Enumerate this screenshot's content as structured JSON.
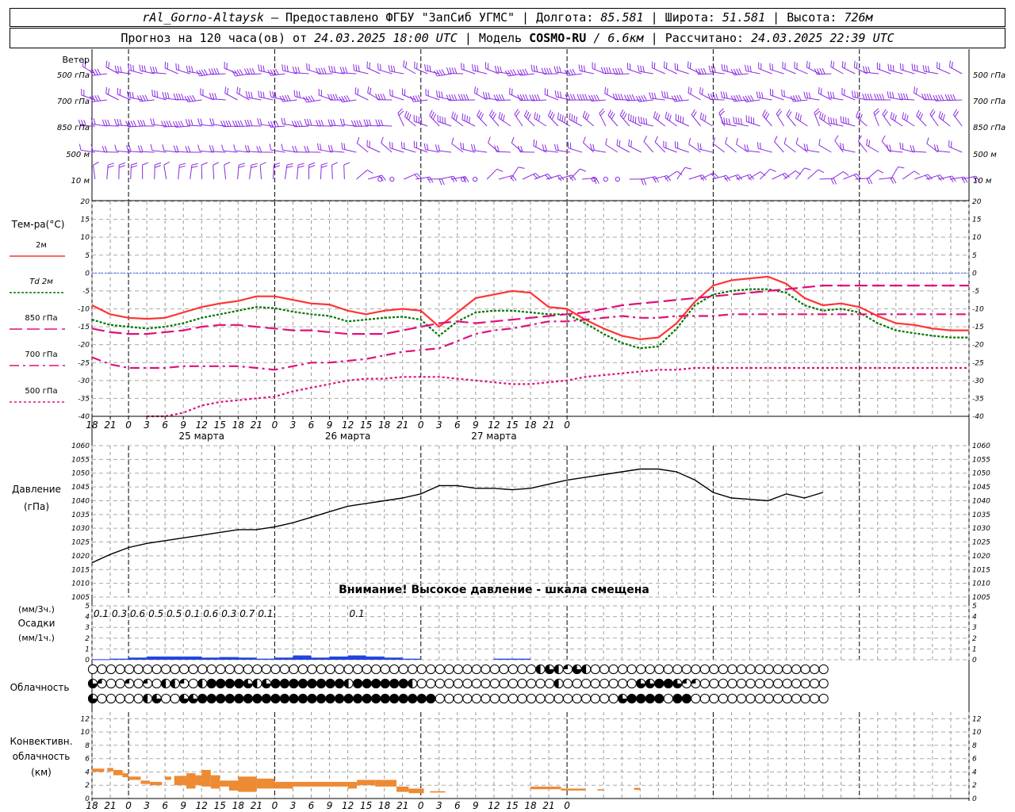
{
  "header": {
    "station": "rAl_Gorno-Altaysk",
    "provider": "Предоставлено ФГБУ \"ЗапСиб УГМС\"",
    "lon_label": "Долгота:",
    "lon_value": "85.581",
    "lat_label": "Широта:",
    "lat_value": "51.581",
    "alt_label": "Высота:",
    "alt_value": "726м",
    "forecast_label": "Прогноз на 120 часа(ов) от",
    "forecast_from": "24.03.2025 18:00 UTC",
    "model_label": "Модель",
    "model_name": "COSMO-RU",
    "model_res": "/ 6.6км",
    "computed_label": "Рассчитано:",
    "computed_at": "24.03.2025 22:39 UTC"
  },
  "wind_panel": {
    "title": "Ветер",
    "levels": [
      "500 гПа",
      "700 гПа",
      "850 гПа",
      "500 м",
      "10 м"
    ]
  },
  "temp_panel": {
    "title": "Тем-ра(°С)",
    "legend": [
      {
        "label": "2м",
        "color": "#ff3333",
        "style": "solid"
      },
      {
        "label": "Td 2м",
        "color": "#007700",
        "style": "dotted"
      },
      {
        "label": "850 гПа",
        "color": "#e0107a",
        "style": "dash"
      },
      {
        "label": "700 гПа",
        "color": "#e0107a",
        "style": "dashdot"
      },
      {
        "label": "500 гПа",
        "color": "#e0107a",
        "style": "dot"
      }
    ]
  },
  "pressure_panel": {
    "title": "Давление",
    "unit": "(гПа)",
    "warning": "Внимание! Высокое давление - шкала смещена"
  },
  "precip_panel": {
    "unit1": "(мм/3ч.)",
    "title": "Осадки",
    "unit2": "(мм/1ч.)",
    "totals": [
      "0.1",
      "0.3",
      "0.6",
      "0.5",
      "0.5",
      "0.1",
      "0.6",
      "0.3",
      "0.7",
      "0.1",
      "0.1"
    ]
  },
  "cloud_panel": {
    "title": "Облачность"
  },
  "conv_panel": {
    "title1": "Конвективн.",
    "title2": "облачность",
    "unit": "(км)"
  },
  "time_axis": {
    "hour_ticks": [
      "18",
      "21",
      "0",
      "3",
      "6",
      "9",
      "12",
      "15",
      "18",
      "21",
      "0",
      "3",
      "6",
      "9",
      "12",
      "15",
      "18",
      "21",
      "0",
      "3",
      "6",
      "9",
      "12",
      "15",
      "18",
      "21",
      "0"
    ],
    "day_labels": [
      "25 марта",
      "26 марта",
      "27 марта"
    ]
  },
  "colors": {
    "wind": "#8a2be2",
    "temp2m": "#ff3333",
    "dew": "#007700",
    "upper": "#e0107a",
    "pressure": "#000000",
    "precip": "#2244dd",
    "conv": "#ee8a33",
    "zero_line": "#3355ff"
  },
  "chart_data": [
    {
      "type": "line",
      "title": "Тем-ра(°С)",
      "x_unit": "hours since 24.03.2025 18:00 UTC",
      "ylim": [
        -40,
        20
      ],
      "yticks": [
        -40,
        -35,
        -30,
        -25,
        -20,
        -15,
        -10,
        -5,
        0,
        5,
        10,
        15,
        20
      ],
      "x": [
        0,
        3,
        6,
        9,
        12,
        15,
        18,
        21,
        24,
        27,
        30,
        33,
        36,
        39,
        42,
        45,
        48,
        51,
        54,
        57,
        60,
        63,
        66,
        69,
        72,
        75,
        78,
        81,
        84,
        87,
        90,
        93,
        96,
        99,
        102,
        105,
        108,
        111,
        114,
        117,
        120,
        123,
        126,
        129,
        132,
        135,
        138,
        141,
        144
      ],
      "series": [
        {
          "name": "2м",
          "values": [
            -9,
            -11.5,
            -12.5,
            -12.8,
            -12.5,
            -11,
            -9.5,
            -8.5,
            -7.8,
            -6.5,
            -6.5,
            -7.5,
            -8.5,
            -8.8,
            -10.5,
            -11.5,
            -10.5,
            -10,
            -10.5,
            -15,
            -11,
            -7,
            -6,
            -5,
            -5.5,
            -9.5,
            -10,
            -13,
            -15.5,
            -17.5,
            -18.5,
            -18,
            -14,
            -8,
            -3.5,
            -2,
            -1.5,
            -1,
            -3,
            -7,
            -9,
            -8.5,
            -9.5,
            -12,
            -14,
            -14.5,
            -15.5,
            -16,
            -16
          ]
        },
        {
          "name": "Td 2м",
          "values": [
            -13,
            -14.5,
            -15,
            -15.5,
            -15,
            -14,
            -12.5,
            -11.5,
            -10.5,
            -9.5,
            -9.8,
            -10.8,
            -11.5,
            -12,
            -13.5,
            -13,
            -12.5,
            -12.2,
            -13,
            -17.5,
            -13.5,
            -11,
            -10.5,
            -10.5,
            -11,
            -11.5,
            -11.5,
            -14,
            -17,
            -19.5,
            -21,
            -20.5,
            -15.5,
            -9,
            -6,
            -5,
            -4.5,
            -4.5,
            -5.5,
            -9,
            -10.5,
            -10,
            -11,
            -14,
            -16,
            -16.8,
            -17.5,
            -18,
            -18
          ]
        },
        {
          "name": "850 гПа",
          "values": [
            -15.5,
            -16.5,
            -17,
            -17,
            -16.5,
            -16,
            -15,
            -14.5,
            -14.5,
            -15,
            -15.5,
            -16,
            -16,
            -16.5,
            -17,
            -17,
            -17,
            -16,
            -15,
            -14,
            -13.5,
            -14,
            -13.5,
            -13,
            -12.5,
            -12,
            -11.5,
            -11,
            -10,
            -9,
            -8.5,
            -8,
            -7.5,
            -7,
            -6.5,
            -6,
            -5.5,
            -5,
            -4.5,
            -4,
            -3.5,
            -3.5,
            -3.5,
            -3.5,
            -3.5,
            -3.5,
            -3.5,
            -3.5,
            -3.5
          ]
        },
        {
          "name": "700 гПа",
          "values": [
            -23.5,
            -25.5,
            -26.5,
            -26.5,
            -26.5,
            -26,
            -26,
            -26,
            -26,
            -26.5,
            -27,
            -26,
            -25,
            -25,
            -24.5,
            -24,
            -23,
            -22,
            -21.5,
            -21,
            -19,
            -17,
            -16,
            -15.5,
            -14.5,
            -13.5,
            -13.5,
            -13,
            -12.5,
            -12,
            -12.5,
            -12.5,
            -12,
            -12,
            -12,
            -11.5,
            -11.5,
            -11.5,
            -11.5,
            -11.5,
            -11.5,
            -11.5,
            -11.5,
            -11.5,
            -11.5,
            -11.5,
            -11.5,
            -11.5,
            -11.5
          ]
        },
        {
          "name": "500 гПа",
          "values": [
            -45,
            -43,
            -42,
            -41,
            -40,
            -39,
            -37,
            -36,
            -35.5,
            -35,
            -34.5,
            -33,
            -32,
            -31,
            -30,
            -29.5,
            -29.5,
            -29,
            -29,
            -29,
            -29.5,
            -30,
            -30.5,
            -31,
            -31,
            -30.5,
            -30,
            -29,
            -28.5,
            -28,
            -27.5,
            -27,
            -27,
            -26.5,
            -26.5,
            -26.5,
            -26.5,
            -26.5,
            -26.5,
            -26.5,
            -26.5,
            -26.5,
            -26.5,
            -26.5,
            -26.5,
            -26.5,
            -26.5,
            -26.5,
            -26.5
          ]
        }
      ]
    },
    {
      "type": "line",
      "title": "Давление",
      "ylabel": "(гПа)",
      "x_unit": "hours since 24.03.2025 18:00 UTC",
      "ylim": [
        1005,
        1060
      ],
      "yticks": [
        1005,
        1010,
        1015,
        1020,
        1025,
        1030,
        1035,
        1040,
        1045,
        1050,
        1055,
        1060
      ],
      "x": [
        0,
        3,
        6,
        9,
        12,
        15,
        18,
        21,
        24,
        27,
        30,
        33,
        36,
        39,
        42,
        45,
        48,
        51,
        54,
        57,
        60,
        63,
        66,
        69,
        72,
        75,
        78,
        81,
        84,
        87,
        90,
        93,
        96,
        99,
        102,
        105,
        108,
        111,
        114,
        117,
        120
      ],
      "series": [
        {
          "name": "",
          "values": [
            1017.5,
            1020.5,
            1023,
            1024.5,
            1025.5,
            1026.5,
            1027.5,
            1028.5,
            1029.5,
            1029.5,
            1030.5,
            1032,
            1034,
            1036,
            1038,
            1039,
            1040,
            1041,
            1042.5,
            1045.5,
            1045.5,
            1044.5,
            1044.5,
            1044,
            1044.5,
            1046,
            1047.5,
            1048.5,
            1049.5,
            1050.5,
            1051.5,
            1051.5,
            1050.5,
            1047.5,
            1043,
            1041,
            1040.5,
            1040,
            1042.5,
            1041,
            1043
          ]
        }
      ]
    },
    {
      "type": "bar",
      "title": "Осадки",
      "ylabel": "(мм/3ч.) (мм/1ч.)",
      "x_unit": "hours since 24.03.2025 18:00 UTC",
      "ylim": [
        0,
        5
      ],
      "yticks": [
        0,
        1,
        2,
        3,
        4,
        5
      ],
      "x": [
        3,
        6,
        9,
        12,
        15,
        18,
        21,
        24,
        27,
        30,
        33,
        36,
        39,
        42,
        45,
        48,
        51,
        54,
        69,
        72
      ],
      "values": [
        0.05,
        0.1,
        0.2,
        0.3,
        0.3,
        0.3,
        0.2,
        0.25,
        0.2,
        0.1,
        0.2,
        0.4,
        0.2,
        0.3,
        0.4,
        0.3,
        0.2,
        0.1,
        0.1,
        0.1
      ],
      "labels_3h": [
        {
          "x": 1.5,
          "text": "0.1"
        },
        {
          "x": 4.5,
          "text": "0.3"
        },
        {
          "x": 7.5,
          "text": "0.6"
        },
        {
          "x": 10.5,
          "text": "0.5"
        },
        {
          "x": 13.5,
          "text": "0.5"
        },
        {
          "x": 16.5,
          "text": "0.1"
        },
        {
          "x": 19.5,
          "text": "0.6"
        },
        {
          "x": 22.5,
          "text": "0.3"
        },
        {
          "x": 25.5,
          "text": "0.7"
        },
        {
          "x": 28.5,
          "text": "0.1"
        },
        {
          "x": 43.5,
          "text": "0.1"
        }
      ]
    },
    {
      "type": "heatmap",
      "title": "Облачность",
      "rows": [
        "upper",
        "middle",
        "lower"
      ],
      "x_unit": "hours since 24.03.2025 18:00 UTC",
      "x_step_hours": 1.5,
      "cover_scale": "0=clear, 1=quarter, 2=half, 3=three-quarters, 4=overcast",
      "values": [
        [
          0,
          0,
          0,
          0,
          0,
          0,
          0,
          0,
          0,
          0,
          0,
          0,
          0,
          0,
          0,
          0,
          0,
          0,
          0,
          0,
          0,
          0,
          0,
          0,
          0,
          0,
          0,
          0,
          0,
          0,
          0,
          0,
          0,
          0,
          0,
          0,
          0,
          0,
          0,
          0,
          0,
          0,
          0,
          0,
          0,
          0,
          0,
          0,
          0,
          2,
          3,
          2,
          1,
          3,
          2,
          0,
          0,
          0,
          0,
          0,
          0,
          0,
          0,
          0,
          0,
          0,
          0,
          0,
          0,
          0,
          0,
          0,
          0,
          0,
          0,
          0,
          0,
          0,
          0,
          0,
          0
        ],
        [
          3,
          1,
          0,
          0,
          1,
          0,
          1,
          0,
          2,
          2,
          1,
          0,
          2,
          4,
          4,
          4,
          4,
          3,
          2,
          3,
          4,
          4,
          4,
          4,
          4,
          4,
          4,
          4,
          2,
          4,
          4,
          4,
          4,
          4,
          4,
          2,
          0,
          0,
          0,
          0,
          0,
          0,
          0,
          0,
          0,
          0,
          0,
          0,
          0,
          0,
          0,
          2,
          0,
          0,
          0,
          0,
          0,
          0,
          0,
          0,
          3,
          3,
          4,
          4,
          3,
          1,
          1,
          0,
          0,
          0,
          0,
          0,
          0,
          0,
          0,
          0,
          0,
          0,
          0,
          0,
          0
        ],
        [
          3,
          0,
          0,
          0,
          0,
          0,
          2,
          3,
          0,
          0,
          3,
          3,
          4,
          4,
          4,
          4,
          4,
          4,
          4,
          4,
          4,
          4,
          4,
          4,
          4,
          4,
          4,
          4,
          4,
          4,
          4,
          4,
          4,
          4,
          4,
          4,
          4,
          4,
          0,
          0,
          0,
          0,
          0,
          0,
          0,
          0,
          0,
          0,
          0,
          0,
          0,
          0,
          0,
          0,
          0,
          0,
          0,
          0,
          3,
          4,
          4,
          4,
          4,
          0,
          4,
          4,
          0,
          0,
          0,
          0,
          0,
          0,
          0,
          0,
          0,
          0,
          0,
          0,
          0,
          0,
          0
        ]
      ]
    },
    {
      "type": "bar",
      "title": "Конвективн. облачность",
      "ylabel": "(км)",
      "x_unit": "hours since 24.03.2025 18:00 UTC",
      "ylim": [
        0,
        13
      ],
      "yticks": [
        0,
        2,
        4,
        6,
        8,
        10,
        12
      ],
      "segments": [
        {
          "x0": 0,
          "x1": 2,
          "bottom": 4.0,
          "top": 4.5
        },
        {
          "x0": 2.5,
          "x1": 3.5,
          "bottom": 4.1,
          "top": 4.6
        },
        {
          "x0": 3.5,
          "x1": 5,
          "bottom": 3.5,
          "top": 4.3
        },
        {
          "x0": 5,
          "x1": 6,
          "bottom": 3.2,
          "top": 3.8
        },
        {
          "x0": 6,
          "x1": 8,
          "bottom": 2.8,
          "top": 3.3
        },
        {
          "x0": 8,
          "x1": 9.5,
          "bottom": 2.2,
          "top": 2.7
        },
        {
          "x0": 9.5,
          "x1": 11.5,
          "bottom": 2.0,
          "top": 2.5
        },
        {
          "x0": 12,
          "x1": 13,
          "bottom": 2.8,
          "top": 3.3
        },
        {
          "x0": 13.5,
          "x1": 15.5,
          "bottom": 2.0,
          "top": 3.4
        },
        {
          "x0": 15.5,
          "x1": 17,
          "bottom": 1.5,
          "top": 3.8
        },
        {
          "x0": 17,
          "x1": 18,
          "bottom": 2.0,
          "top": 3.5
        },
        {
          "x0": 18,
          "x1": 19.5,
          "bottom": 1.8,
          "top": 4.3
        },
        {
          "x0": 19.5,
          "x1": 21,
          "bottom": 1.5,
          "top": 3.5
        },
        {
          "x0": 21,
          "x1": 22.5,
          "bottom": 1.8,
          "top": 2.7
        },
        {
          "x0": 22.5,
          "x1": 24,
          "bottom": 1.2,
          "top": 2.7
        },
        {
          "x0": 24,
          "x1": 27,
          "bottom": 1.0,
          "top": 3.3
        },
        {
          "x0": 27,
          "x1": 30,
          "bottom": 1.5,
          "top": 3.0
        },
        {
          "x0": 30,
          "x1": 33,
          "bottom": 1.5,
          "top": 2.5
        },
        {
          "x0": 33,
          "x1": 42,
          "bottom": 1.8,
          "top": 2.5
        },
        {
          "x0": 42,
          "x1": 43.5,
          "bottom": 1.5,
          "top": 2.5
        },
        {
          "x0": 43.5,
          "x1": 45,
          "bottom": 2.0,
          "top": 2.8
        },
        {
          "x0": 45,
          "x1": 46.5,
          "bottom": 2.0,
          "top": 2.8
        },
        {
          "x0": 46.5,
          "x1": 50,
          "bottom": 1.8,
          "top": 2.8
        },
        {
          "x0": 50,
          "x1": 52,
          "bottom": 1.0,
          "top": 1.8
        },
        {
          "x0": 52,
          "x1": 54.5,
          "bottom": 0.8,
          "top": 1.5
        },
        {
          "x0": 55.5,
          "x1": 58,
          "bottom": 0.9,
          "top": 1.1
        },
        {
          "x0": 72,
          "x1": 77,
          "bottom": 1.4,
          "top": 1.8
        },
        {
          "x0": 77,
          "x1": 81,
          "bottom": 1.2,
          "top": 1.5
        },
        {
          "x0": 83,
          "x1": 84,
          "bottom": 1.2,
          "top": 1.4
        },
        {
          "x0": 89,
          "x1": 90,
          "bottom": 1.3,
          "top": 1.6
        }
      ]
    }
  ]
}
